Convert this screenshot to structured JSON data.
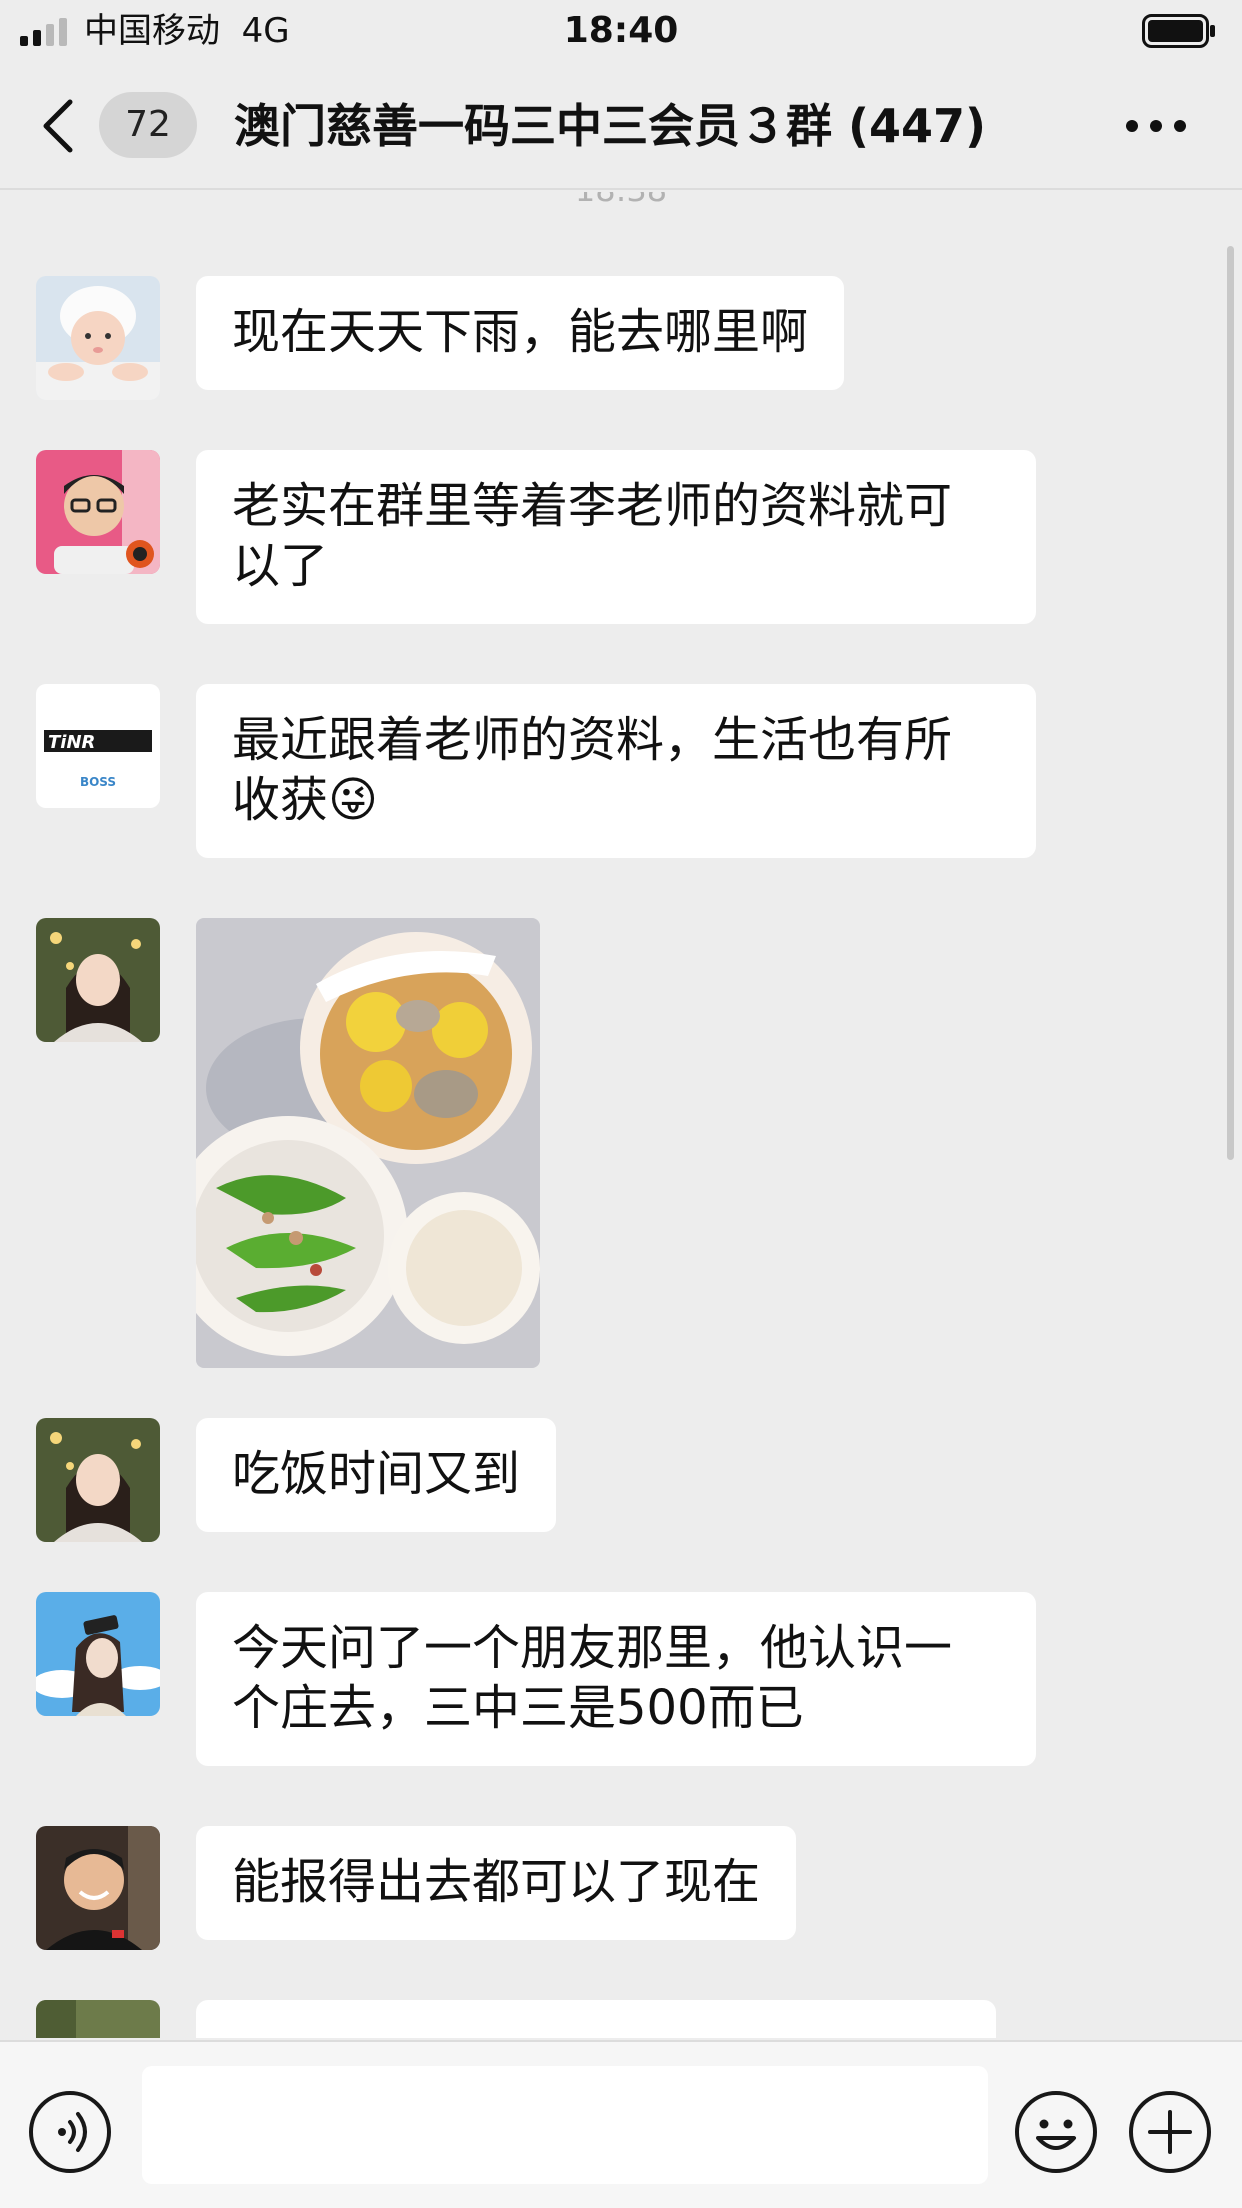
{
  "status_bar": {
    "carrier": "中国移动",
    "network": "4G",
    "time": "18:40"
  },
  "nav": {
    "unread_count": "72",
    "title": "澳门慈善一码三中三会员３群 (447)"
  },
  "chat": {
    "time_separator": "18:38",
    "messages": [
      {
        "type": "text",
        "text": "现在天天下雨，能去哪里啊"
      },
      {
        "type": "text",
        "line1": "老实在群里等着李老师的资料就可",
        "line2": "以了"
      },
      {
        "type": "text",
        "line1": "最近跟着老师的资料，生活也有所",
        "line2": "收获",
        "emoji": "😜"
      },
      {
        "type": "image",
        "description": "food-photo"
      },
      {
        "type": "text",
        "text": "吃饭时间又到"
      },
      {
        "type": "text",
        "line1": "今天问了一个朋友那里，他认识一",
        "line2": "个庄去，三中三是500而已"
      },
      {
        "type": "text",
        "text": "能报得出去都可以了现在"
      }
    ]
  },
  "avatars": {
    "a3_caption_main": "TiNR",
    "a3_caption_sub": "BOSS"
  },
  "colors": {
    "background": "#ededed",
    "bubble": "#ffffff",
    "input_bar": "#f6f6f6"
  }
}
